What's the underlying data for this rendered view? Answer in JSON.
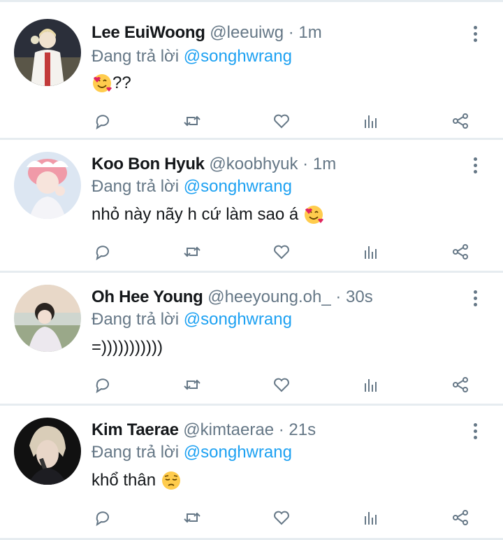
{
  "tweets": [
    {
      "name": "Lee EuiWoong",
      "handle": "@leeuiwg",
      "time": "1m",
      "reply_prefix": "Đang trả lời",
      "reply_to": "@songhwrang",
      "text_before": "",
      "text_after": "??",
      "emoji": "smiling-face-with-hearts-icon",
      "emoji_position": "before"
    },
    {
      "name": "Koo Bon Hyuk",
      "handle": "@koobhyuk",
      "time": "1m",
      "reply_prefix": "Đang trả lời",
      "reply_to": "@songhwrang",
      "text_before": "nhỏ này nãy h cứ làm sao á ",
      "text_after": "",
      "emoji": "smiling-face-with-hearts-icon",
      "emoji_position": "after"
    },
    {
      "name": "Oh Hee Young",
      "handle": "@heeyoung.oh_",
      "time": "30s",
      "reply_prefix": "Đang trả lời",
      "reply_to": "@songhwrang",
      "text_before": "=)))))))))))",
      "text_after": "",
      "emoji": "",
      "emoji_position": "none"
    },
    {
      "name": "Kim Taerae",
      "handle": "@kimtaerae",
      "time": "21s",
      "reply_prefix": "Đang trả lời",
      "reply_to": "@songhwrang",
      "text_before": "khổ thân ",
      "text_after": "",
      "emoji": "pensive-face-icon",
      "emoji_position": "after"
    }
  ],
  "separator": " · ",
  "colors": {
    "name": "#14171a",
    "secondary": "#657786",
    "mention": "#1da1f2",
    "divider": "#e6ecf0"
  }
}
